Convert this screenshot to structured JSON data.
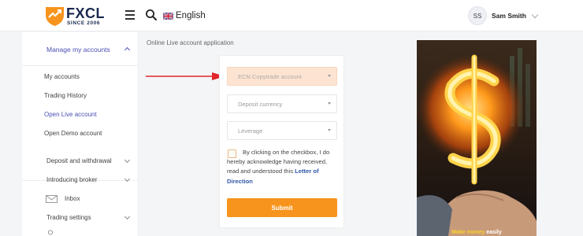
{
  "header": {
    "brand": "FXCL",
    "brand_tagline": "SINCE 2006",
    "language": "English",
    "user_initials": "SS",
    "user_name": "Sam Smith"
  },
  "sidebar": {
    "section_label": "Manage my accounts",
    "sub_items": [
      {
        "label": "My accounts",
        "active": false
      },
      {
        "label": "Trading History",
        "active": false
      },
      {
        "label": "Open Live account",
        "active": true
      },
      {
        "label": "Open Demo account",
        "active": false
      }
    ],
    "items": [
      {
        "label": "Deposit and withdrawal"
      },
      {
        "label": "Introducing broker"
      },
      {
        "label": "Inbox"
      },
      {
        "label": "Trading settings"
      }
    ]
  },
  "main": {
    "breadcrumb": "Online Live account application",
    "form": {
      "account_type_placeholder": "ECN Copytrade account",
      "deposit_currency_placeholder": "Deposit currency",
      "leverage_placeholder": "Leverage",
      "consent_text": "By clicking on the checkbox, I do hereby acknowledge having received, read and understood this",
      "consent_link": "Letter of Direction",
      "submit_label": "Submit"
    }
  },
  "banner": {
    "caption_highlight": "Make money",
    "caption_rest": "easily"
  },
  "colors": {
    "accent": "#f7941d",
    "nav_active": "#4a4fb5",
    "highlight_field": "#fde4d2",
    "annotation_arrow": "#e0262a"
  }
}
